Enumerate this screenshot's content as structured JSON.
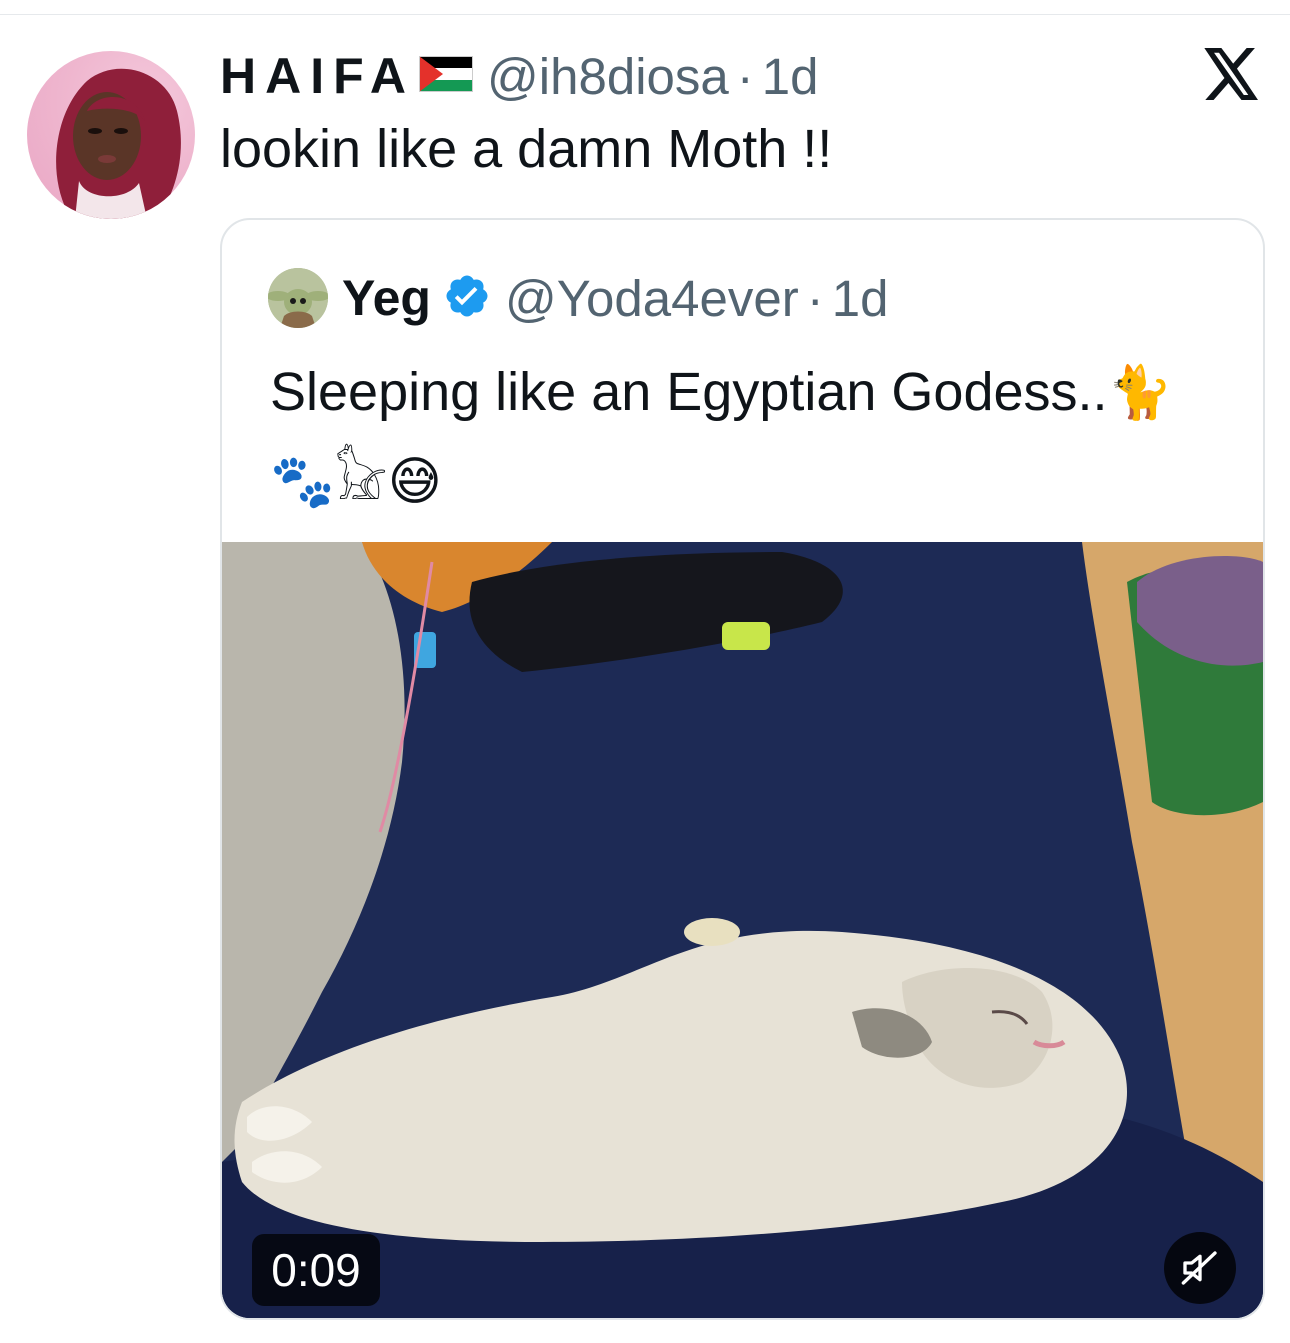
{
  "tweet": {
    "display_name": "HAIFA",
    "flag_icon": "palestine-flag-icon",
    "handle": "@ih8diosa",
    "separator": "·",
    "time": "1d",
    "text": "lookin like a damn Moth !!"
  },
  "quoted_tweet": {
    "display_name": "Yeg",
    "verified": true,
    "handle": "@Yoda4ever",
    "separator": "·",
    "time": "1d",
    "text_line1": "Sleeping like an Egyptian Godess..",
    "emoji_cat": "🐈",
    "emoji_paws": "🐾",
    "emoji_cat2": "𓃠",
    "emoji_face": "😅"
  },
  "video": {
    "duration": "0:09",
    "muted": true
  },
  "colors": {
    "secondary_text": "#536471",
    "verified_blue": "#1d9bf0",
    "border": "#e1e5e8"
  }
}
